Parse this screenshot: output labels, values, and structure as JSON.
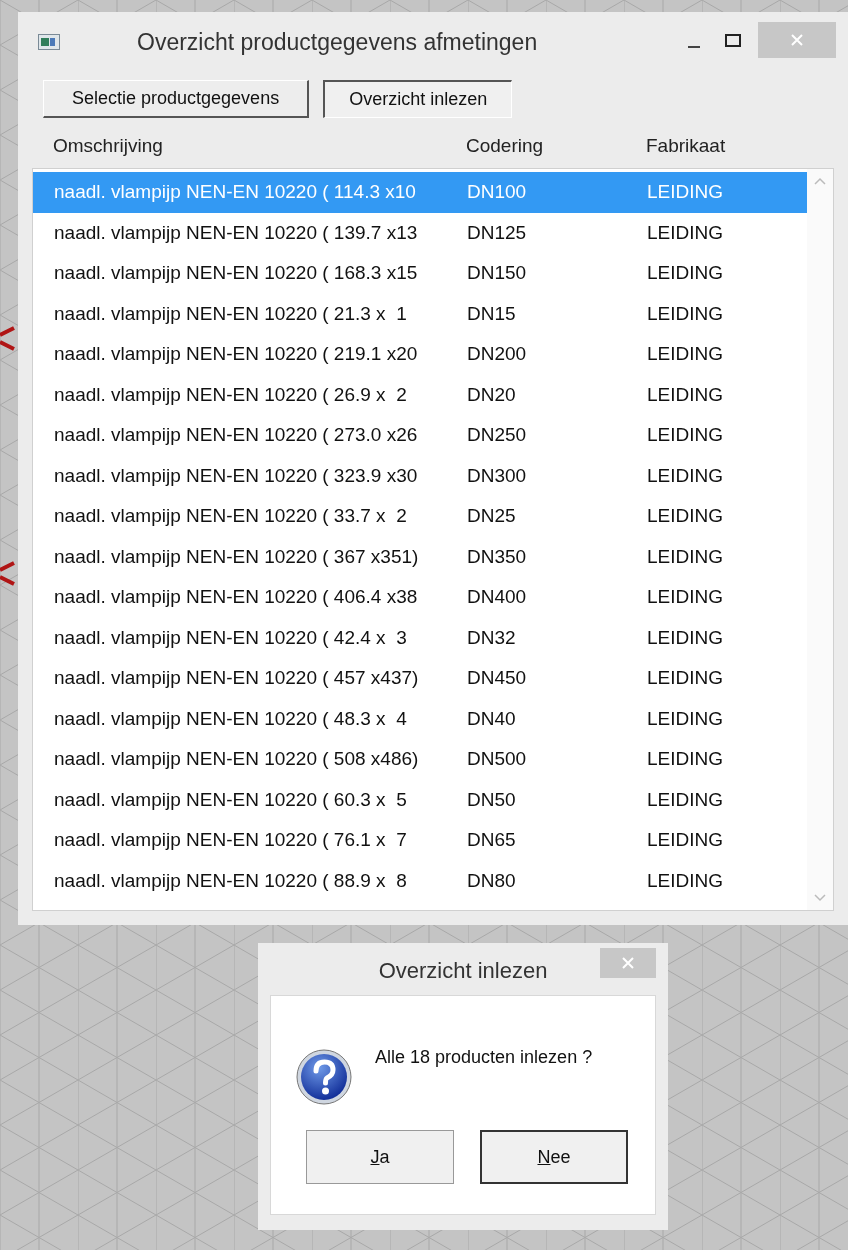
{
  "window": {
    "title": "Overzicht productgegevens afmetingen"
  },
  "buttons": [
    {
      "label": "Selectie productgegevens",
      "pressed": false
    },
    {
      "label": "Overzicht inlezen",
      "pressed": true
    }
  ],
  "table": {
    "columns": [
      "Omschrijving",
      "Codering",
      "Fabrikaat"
    ],
    "rows": [
      {
        "cells": [
          "naadl. vlampijp NEN-EN 10220 ( 114.3 x10",
          "DN100",
          "LEIDING"
        ],
        "selected": true
      },
      {
        "cells": [
          "naadl. vlampijp NEN-EN 10220 ( 139.7 x13",
          "DN125",
          "LEIDING"
        ],
        "selected": false
      },
      {
        "cells": [
          "naadl. vlampijp NEN-EN 10220 ( 168.3 x15",
          "DN150",
          "LEIDING"
        ],
        "selected": false
      },
      {
        "cells": [
          "naadl. vlampijp NEN-EN 10220 ( 21.3 x  1",
          "DN15",
          "LEIDING"
        ],
        "selected": false
      },
      {
        "cells": [
          "naadl. vlampijp NEN-EN 10220 ( 219.1 x20",
          "DN200",
          "LEIDING"
        ],
        "selected": false
      },
      {
        "cells": [
          "naadl. vlampijp NEN-EN 10220 ( 26.9 x  2",
          "DN20",
          "LEIDING"
        ],
        "selected": false
      },
      {
        "cells": [
          "naadl. vlampijp NEN-EN 10220 ( 273.0 x26",
          "DN250",
          "LEIDING"
        ],
        "selected": false
      },
      {
        "cells": [
          "naadl. vlampijp NEN-EN 10220 ( 323.9 x30",
          "DN300",
          "LEIDING"
        ],
        "selected": false
      },
      {
        "cells": [
          "naadl. vlampijp NEN-EN 10220 ( 33.7 x  2",
          "DN25",
          "LEIDING"
        ],
        "selected": false
      },
      {
        "cells": [
          "naadl. vlampijp NEN-EN 10220 ( 367 x351)",
          "DN350",
          "LEIDING"
        ],
        "selected": false
      },
      {
        "cells": [
          "naadl. vlampijp NEN-EN 10220 ( 406.4 x38",
          "DN400",
          "LEIDING"
        ],
        "selected": false
      },
      {
        "cells": [
          "naadl. vlampijp NEN-EN 10220 ( 42.4 x  3",
          "DN32",
          "LEIDING"
        ],
        "selected": false
      },
      {
        "cells": [
          "naadl. vlampijp NEN-EN 10220 ( 457 x437)",
          "DN450",
          "LEIDING"
        ],
        "selected": false
      },
      {
        "cells": [
          "naadl. vlampijp NEN-EN 10220 ( 48.3 x  4",
          "DN40",
          "LEIDING"
        ],
        "selected": false
      },
      {
        "cells": [
          "naadl. vlampijp NEN-EN 10220 ( 508 x486)",
          "DN500",
          "LEIDING"
        ],
        "selected": false
      },
      {
        "cells": [
          "naadl. vlampijp NEN-EN 10220 ( 60.3 x  5",
          "DN50",
          "LEIDING"
        ],
        "selected": false
      },
      {
        "cells": [
          "naadl. vlampijp NEN-EN 10220 ( 76.1 x  7",
          "DN65",
          "LEIDING"
        ],
        "selected": false
      },
      {
        "cells": [
          "naadl. vlampijp NEN-EN 10220 ( 88.9 x  8",
          "DN80",
          "LEIDING"
        ],
        "selected": false
      }
    ]
  },
  "dialog": {
    "title": "Overzicht inlezen",
    "message": "Alle 18 producten inlezen ?",
    "buttons": [
      {
        "label": "Ja",
        "underline_first": true,
        "default": false
      },
      {
        "label": "Nee",
        "underline_first": true,
        "default": true
      }
    ]
  }
}
